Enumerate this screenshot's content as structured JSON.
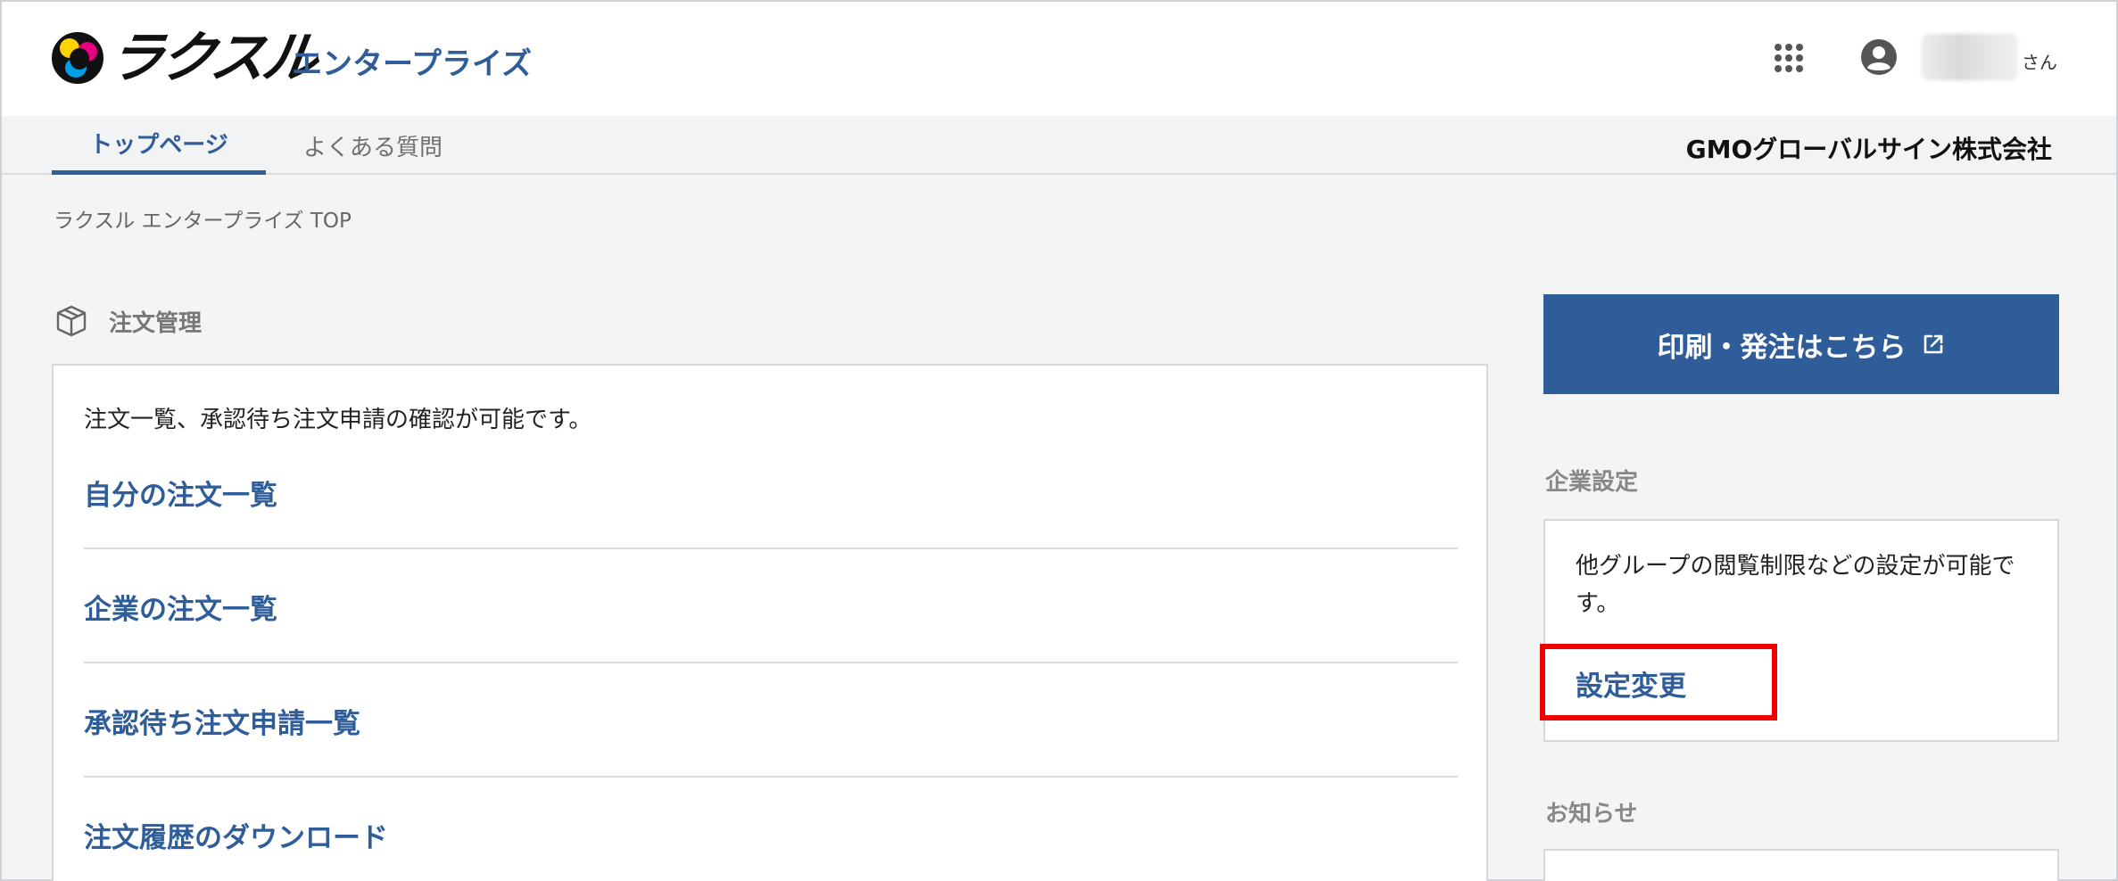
{
  "header": {
    "logo_text": "ラクスル",
    "product_name": "エンタープライズ",
    "user_suffix": "さん"
  },
  "tabs": [
    {
      "label": "トップページ",
      "active": true
    },
    {
      "label": "よくある質問",
      "active": false
    }
  ],
  "company_name": "GMOグローバルサイン株式会社",
  "breadcrumb": "ラクスル エンタープライズ TOP",
  "order_section": {
    "title": "注文管理",
    "description": "注文一覧、承認待ち注文申請の確認が可能です。",
    "links": [
      "自分の注文一覧",
      "企業の注文一覧",
      "承認待ち注文申請一覧",
      "注文履歴のダウンロード"
    ]
  },
  "print_button": {
    "label": "印刷・発注はこちら"
  },
  "company_settings": {
    "heading": "企業設定",
    "description": "他グループの閲覧制限などの設定が可能です。",
    "link": "設定変更"
  },
  "news": {
    "heading": "お知らせ"
  },
  "colors": {
    "brand_blue": "#2f5d9a",
    "highlight_red": "#ee0000",
    "background": "#f3f4f4"
  }
}
